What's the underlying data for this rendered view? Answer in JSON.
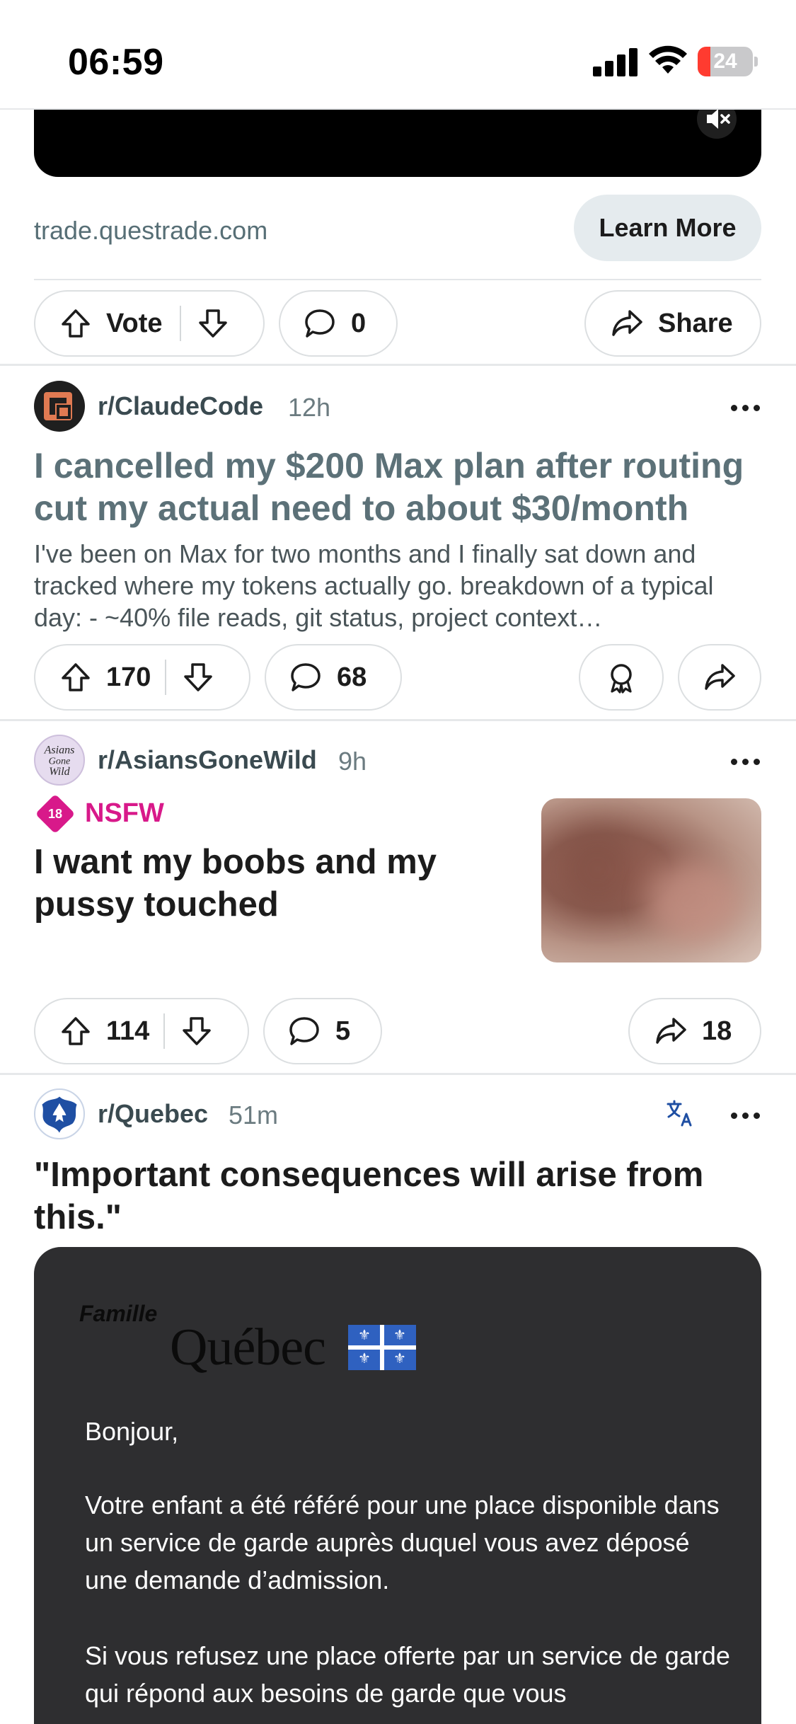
{
  "status_bar": {
    "time": "06:59",
    "battery": "24"
  },
  "ad": {
    "domain": "trade.questrade.com",
    "cta": "Learn More",
    "vote_label": "Vote",
    "comments": "0",
    "share_label": "Share"
  },
  "posts": [
    {
      "subreddit": "r/ClaudeCode",
      "time": "12h",
      "title": "I cancelled my $200 Max plan after routing cut my actual need to about $30/month",
      "body": "I've been on Max for two months and I finally sat down and tracked where my tokens actually go. breakdown of a typical day: - ~40% file reads, git status, project context…",
      "votes": "170",
      "comments": "68"
    },
    {
      "subreddit": "r/AsiansGoneWild",
      "time": "9h",
      "nsfw_label": "NSFW",
      "nsfw_badge": "18",
      "title": "I want my boobs and my pussy touched",
      "votes": "114",
      "comments": "5",
      "shares": "18"
    },
    {
      "subreddit": "r/Quebec",
      "time": "51m",
      "title": "\"Important consequences will arise from this.\"",
      "image": {
        "famille": "Famille",
        "quebec": "Québec",
        "greeting": "Bonjour,",
        "para1": "Votre enfant a été référé pour une place disponible dans un service de garde auprès duquel vous avez déposé une demande d’admission.",
        "para2": "Si vous refusez une place offerte par un service de garde qui répond aux besoins de garde que vous"
      }
    }
  ],
  "colors": {
    "accent_nsfw": "#d8198a",
    "pill_border": "#dcdfe1",
    "cta_bg": "#e5ebee"
  }
}
